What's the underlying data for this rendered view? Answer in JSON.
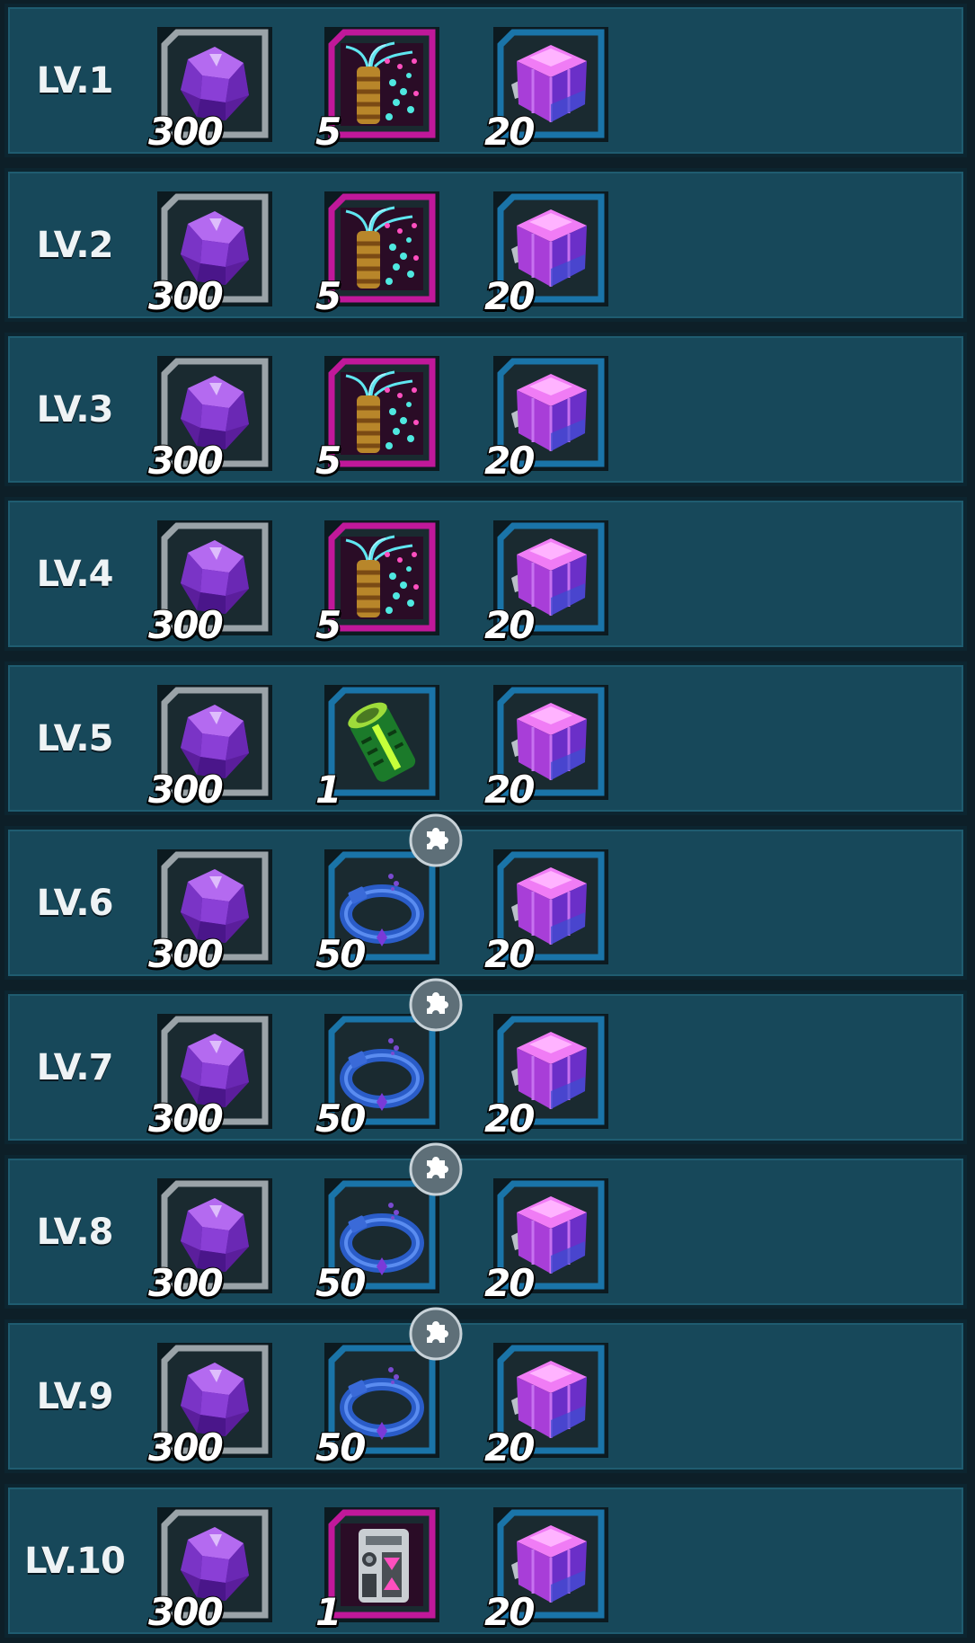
{
  "rows": [
    {
      "level": "LV.1",
      "items": [
        {
          "icon": "purple-gem-icon",
          "qty": "300"
        },
        {
          "icon": "neon-plant-icon",
          "qty": "5"
        },
        {
          "icon": "purple-cube-icon",
          "qty": "20"
        }
      ]
    },
    {
      "level": "LV.2",
      "items": [
        {
          "icon": "purple-gem-icon",
          "qty": "300"
        },
        {
          "icon": "neon-plant-icon",
          "qty": "5"
        },
        {
          "icon": "purple-cube-icon",
          "qty": "20"
        }
      ]
    },
    {
      "level": "LV.3",
      "items": [
        {
          "icon": "purple-gem-icon",
          "qty": "300"
        },
        {
          "icon": "neon-plant-icon",
          "qty": "5"
        },
        {
          "icon": "purple-cube-icon",
          "qty": "20"
        }
      ]
    },
    {
      "level": "LV.4",
      "items": [
        {
          "icon": "purple-gem-icon",
          "qty": "300"
        },
        {
          "icon": "neon-plant-icon",
          "qty": "5"
        },
        {
          "icon": "purple-cube-icon",
          "qty": "20"
        }
      ]
    },
    {
      "level": "LV.5",
      "items": [
        {
          "icon": "purple-gem-icon",
          "qty": "300"
        },
        {
          "icon": "green-canister-icon",
          "qty": "1"
        },
        {
          "icon": "purple-cube-icon",
          "qty": "20"
        }
      ]
    },
    {
      "level": "LV.6",
      "items": [
        {
          "icon": "purple-gem-icon",
          "qty": "300"
        },
        {
          "icon": "blue-collar-icon",
          "qty": "50",
          "fragment": true
        },
        {
          "icon": "purple-cube-icon",
          "qty": "20"
        }
      ]
    },
    {
      "level": "LV.7",
      "items": [
        {
          "icon": "purple-gem-icon",
          "qty": "300"
        },
        {
          "icon": "blue-collar-icon",
          "qty": "50",
          "fragment": true
        },
        {
          "icon": "purple-cube-icon",
          "qty": "20"
        }
      ]
    },
    {
      "level": "LV.8",
      "items": [
        {
          "icon": "purple-gem-icon",
          "qty": "300"
        },
        {
          "icon": "blue-collar-icon",
          "qty": "50",
          "fragment": true
        },
        {
          "icon": "purple-cube-icon",
          "qty": "20"
        }
      ]
    },
    {
      "level": "LV.9",
      "items": [
        {
          "icon": "purple-gem-icon",
          "qty": "300"
        },
        {
          "icon": "blue-collar-icon",
          "qty": "50",
          "fragment": true
        },
        {
          "icon": "purple-cube-icon",
          "qty": "20"
        }
      ]
    },
    {
      "level": "LV.10",
      "items": [
        {
          "icon": "purple-gem-icon",
          "qty": "300"
        },
        {
          "icon": "mech-device-icon",
          "qty": "1"
        },
        {
          "icon": "purple-cube-icon",
          "qty": "20"
        }
      ]
    }
  ],
  "colors": {
    "row_bg": "#17485a",
    "frame_gray": "#9aa3a8",
    "frame_magenta": "#c0189a",
    "frame_blue": "#1a74a8"
  }
}
